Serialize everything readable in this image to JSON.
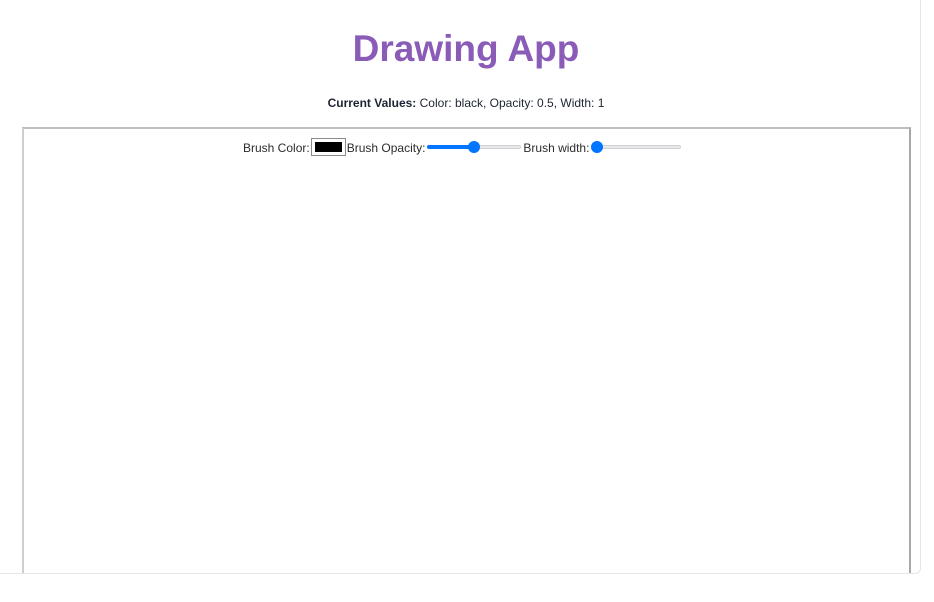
{
  "app": {
    "title": "Drawing App"
  },
  "current_values": {
    "label": "Current Values:",
    "text": "Color: black, Opacity: 0.5, Width: 1"
  },
  "toolbar": {
    "brush_color_label": "Brush Color:",
    "brush_color_value": "#000000",
    "brush_opacity_label": "Brush Opacity:",
    "brush_opacity_fraction": 0.5,
    "brush_width_label": "Brush width:",
    "brush_width_fraction": 0.0
  },
  "colors": {
    "title": "#8a5cb8",
    "slider_accent": "#0075ff"
  }
}
